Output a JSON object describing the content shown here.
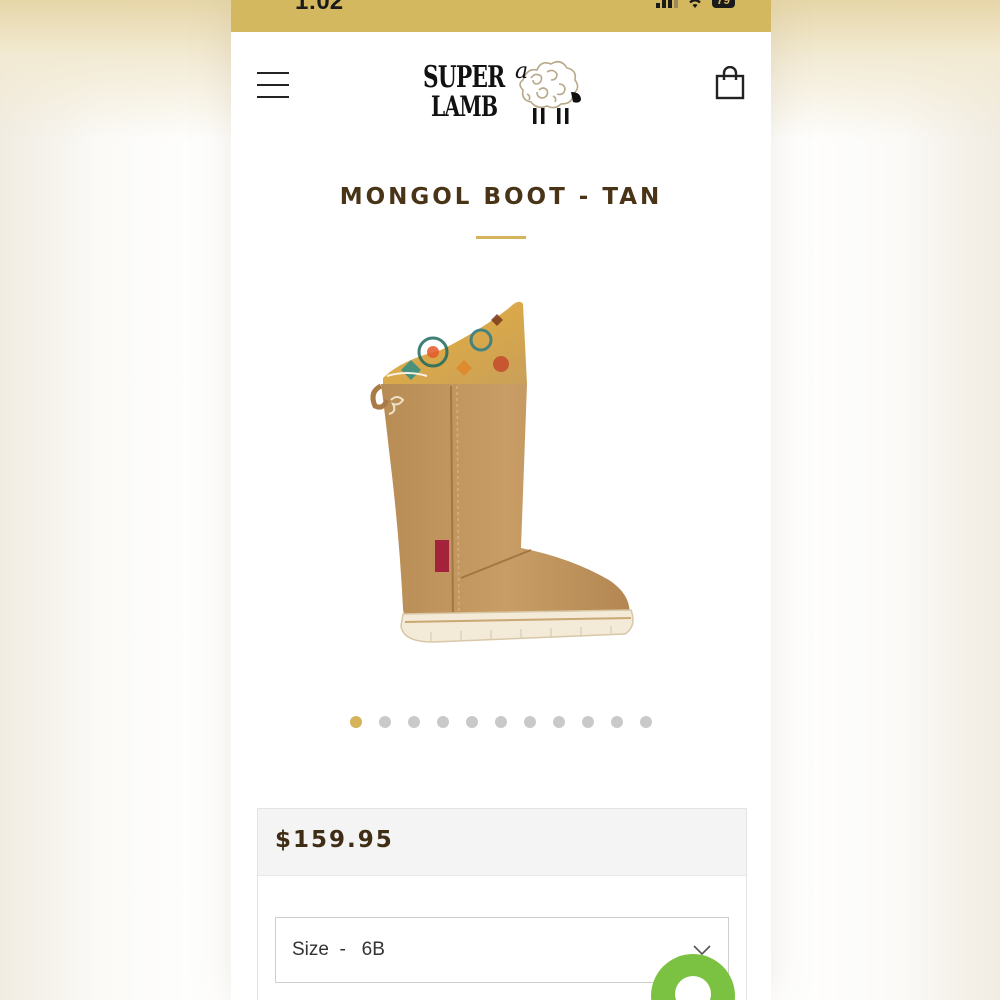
{
  "status_bar": {
    "time": "1:02",
    "battery": "79",
    "signal_icon": "cellular-signal-icon",
    "wifi_icon": "wifi-icon",
    "battery_icon": "battery-icon",
    "background_color": "#d4b860"
  },
  "header": {
    "menu_icon": "hamburger-menu-icon",
    "logo": {
      "line1": "SUPER",
      "line2": "LAMB",
      "script_letter": "a",
      "mark": "sheep-logo-icon"
    },
    "cart_icon": "shopping-bag-icon"
  },
  "product": {
    "title": "MONGOL BOOT - TAN",
    "image": "tan-suede-boot-with-patterned-cuff",
    "accent_color": "#d4b35a"
  },
  "carousel": {
    "count": 11,
    "active_index": 0
  },
  "purchase": {
    "price": "$159.95",
    "size_label": "Size",
    "size_separator": "-",
    "size_value": "6B",
    "size_text": "Size  -   6B",
    "chevron_icon": "chevron-down-icon"
  },
  "chat": {
    "icon": "chat-bubble-icon",
    "color": "#7cc242"
  }
}
